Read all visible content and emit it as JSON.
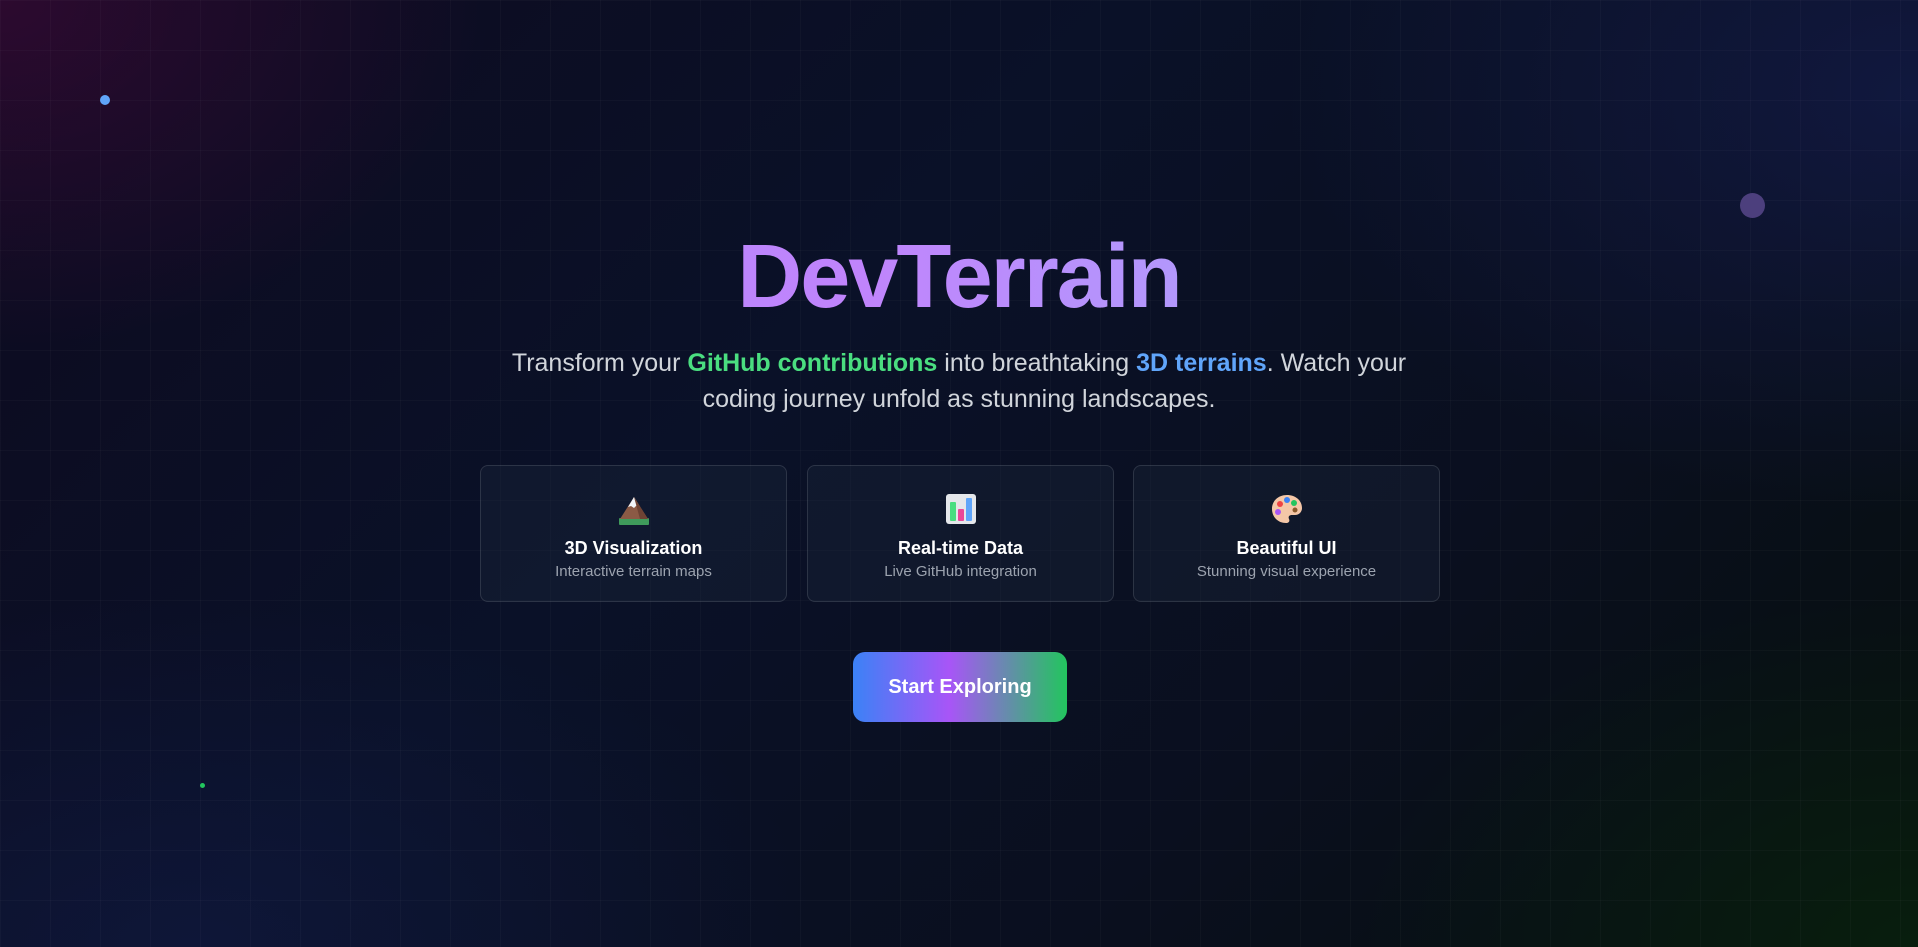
{
  "hero": {
    "title": "DevTerrain",
    "subtitle": {
      "part1": "Transform your ",
      "highlight1": "GitHub contributions",
      "part2": " into breathtaking ",
      "highlight2": "3D terrains",
      "part3": ". Watch your coding journey unfold as stunning landscapes."
    }
  },
  "features": [
    {
      "icon": "mountain-icon",
      "title": "3D Visualization",
      "description": "Interactive terrain maps"
    },
    {
      "icon": "bar-chart-icon",
      "title": "Real-time Data",
      "description": "Live GitHub integration"
    },
    {
      "icon": "palette-icon",
      "title": "Beautiful UI",
      "description": "Stunning visual experience"
    }
  ],
  "cta": {
    "label": "Start Exploring"
  },
  "colors": {
    "title_gradient": [
      "#a78bfa",
      "#c084fc",
      "#93c5fd"
    ],
    "highlight_green": "#4ade80",
    "highlight_blue": "#60a5fa",
    "cta_gradient": [
      "#3b82f6",
      "#a855f7",
      "#22c55e"
    ]
  }
}
